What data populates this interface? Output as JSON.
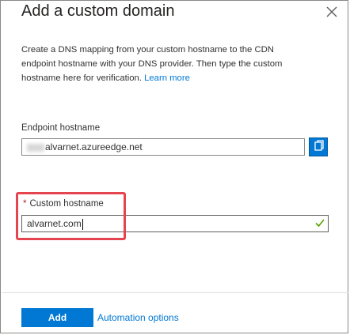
{
  "dialog": {
    "title": "Add a custom domain",
    "description": "Create a DNS mapping from your custom hostname to the CDN endpoint hostname with your DNS provider. Then type the custom hostname here for verification.",
    "learn_more": "Learn more"
  },
  "endpoint": {
    "label": "Endpoint hostname",
    "value": "alvarnet.azureedge.net"
  },
  "custom": {
    "required_marker": "*",
    "label": "Custom hostname",
    "value": "alvarnet.com"
  },
  "footer": {
    "add_label": "Add",
    "automation_label": "Automation options"
  },
  "colors": {
    "accent": "#0078d4",
    "highlight": "#e5454f",
    "valid": "#57a300"
  },
  "icons": {
    "close": "close-icon",
    "copy": "copy-icon",
    "check": "checkmark-icon"
  }
}
